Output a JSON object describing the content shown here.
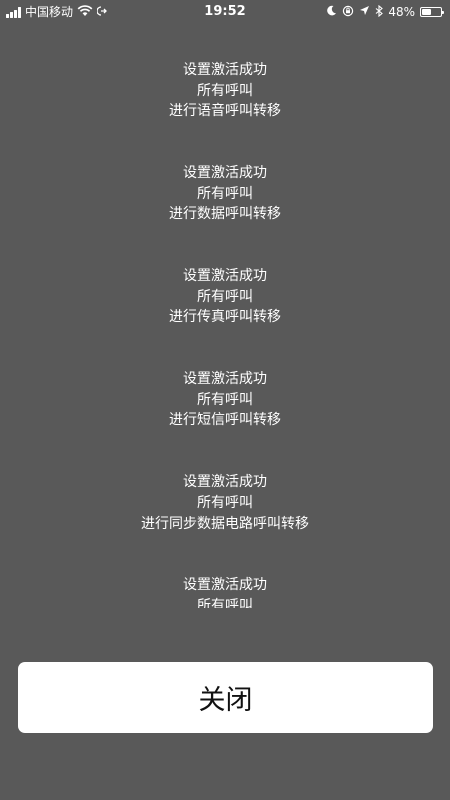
{
  "status_bar": {
    "carrier": "中国移动",
    "time": "19:52",
    "battery_text": "48%",
    "battery_level": 0.48
  },
  "messages": [
    {
      "line1": "设置激活成功",
      "line2": "所有呼叫",
      "line3": "进行语音呼叫转移"
    },
    {
      "line1": "设置激活成功",
      "line2": "所有呼叫",
      "line3": "进行数据呼叫转移"
    },
    {
      "line1": "设置激活成功",
      "line2": "所有呼叫",
      "line3": "进行传真呼叫转移"
    },
    {
      "line1": "设置激活成功",
      "line2": "所有呼叫",
      "line3": "进行短信呼叫转移"
    },
    {
      "line1": "设置激活成功",
      "line2": "所有呼叫",
      "line3": "进行同步数据电路呼叫转移"
    },
    {
      "line1": "设置激活成功",
      "line2": "所有呼叫",
      "line3": ""
    }
  ],
  "close_button": {
    "label": "关闭"
  }
}
